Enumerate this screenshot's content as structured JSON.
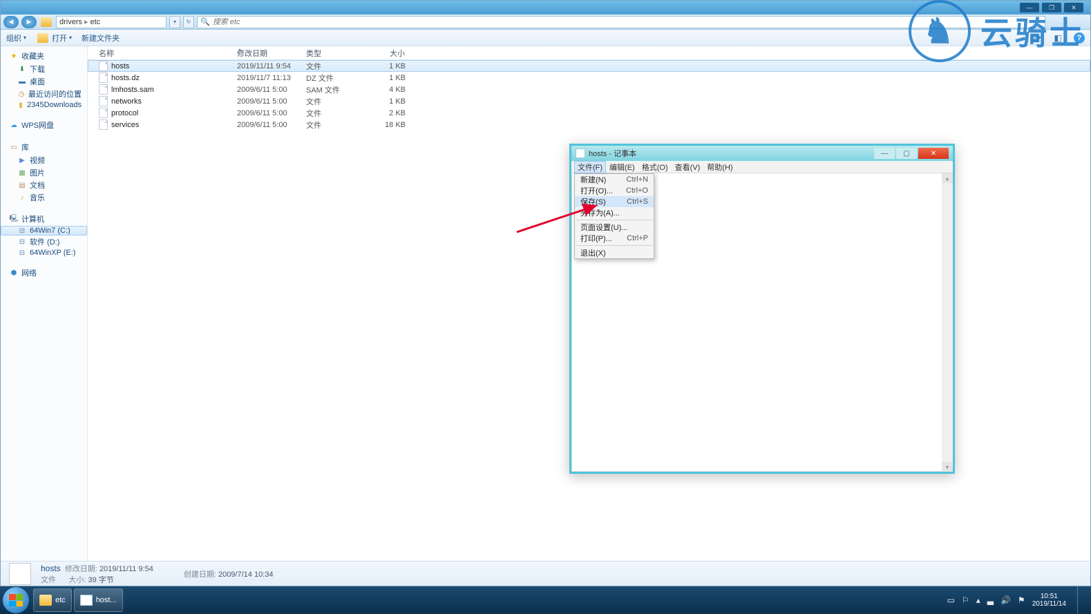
{
  "watermark": "云骑士",
  "explorer": {
    "address": {
      "part1": "drivers",
      "part2": "etc"
    },
    "search_placeholder": "搜索 etc",
    "cmdbar": {
      "org": "组织",
      "open": "打开",
      "newfolder": "新建文件夹"
    },
    "columns": {
      "name": "名称",
      "date": "修改日期",
      "type": "类型",
      "size": "大小"
    },
    "files": [
      {
        "name": "hosts",
        "date": "2019/11/11 9:54",
        "type": "文件",
        "size": "1 KB",
        "sel": true
      },
      {
        "name": "hosts.dz",
        "date": "2019/11/7 11:13",
        "type": "DZ 文件",
        "size": "1 KB"
      },
      {
        "name": "lmhosts.sam",
        "date": "2009/6/11 5:00",
        "type": "SAM 文件",
        "size": "4 KB"
      },
      {
        "name": "networks",
        "date": "2009/6/11 5:00",
        "type": "文件",
        "size": "1 KB"
      },
      {
        "name": "protocol",
        "date": "2009/6/11 5:00",
        "type": "文件",
        "size": "2 KB"
      },
      {
        "name": "services",
        "date": "2009/6/11 5:00",
        "type": "文件",
        "size": "18 KB"
      }
    ],
    "details": {
      "name": "hosts",
      "mod_label": "修改日期:",
      "mod_val": "2019/11/11 9:54",
      "type_val": "文件",
      "size_label": "大小:",
      "size_val": "39 字节",
      "create_label": "创建日期:",
      "create_val": "2009/7/14 10:34"
    },
    "sidebar": {
      "fav": "收藏夹",
      "dl": "下载",
      "desk": "桌面",
      "recent": "最近访问的位置",
      "dl2345": "2345Downloads",
      "wps": "WPS网盘",
      "lib": "库",
      "vid": "视频",
      "pic": "图片",
      "doc": "文档",
      "mus": "音乐",
      "comp": "计算机",
      "c": "64Win7  (C:)",
      "d": "软件  (D:)",
      "e": "64WinXP  (E:)",
      "net": "网络"
    }
  },
  "notepad": {
    "title": "hosts - 记事本",
    "menu": {
      "file": "文件(F)",
      "edit": "编辑(E)",
      "format": "格式(O)",
      "view": "查看(V)",
      "help": "帮助(H)"
    },
    "dropdown": [
      {
        "label": "新建(N)",
        "sc": "Ctrl+N"
      },
      {
        "label": "打开(O)...",
        "sc": "Ctrl+O"
      },
      {
        "label": "保存(S)",
        "sc": "Ctrl+S"
      },
      {
        "label": "另存为(A)...",
        "sc": ""
      },
      {
        "sep": true
      },
      {
        "label": "页面设置(U)...",
        "sc": ""
      },
      {
        "label": "打印(P)...",
        "sc": "Ctrl+P"
      },
      {
        "sep": true
      },
      {
        "label": "退出(X)",
        "sc": ""
      }
    ]
  },
  "taskbar": {
    "etc": "etc",
    "hosts": "host...",
    "time": "10:51",
    "date": "2019/11/14"
  }
}
